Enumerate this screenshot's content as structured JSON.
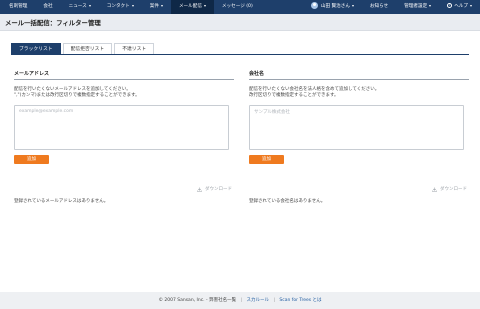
{
  "nav": {
    "items": [
      {
        "label": "名刺管理",
        "caret": false,
        "active": false
      },
      {
        "label": "会社",
        "caret": false,
        "active": false
      },
      {
        "label": "ニュース",
        "caret": true,
        "active": false
      },
      {
        "label": "コンタクト",
        "caret": true,
        "active": false
      },
      {
        "label": "案件",
        "caret": true,
        "active": false
      },
      {
        "label": "メール配信",
        "caret": true,
        "active": true
      },
      {
        "label": "メッセージ (0)",
        "caret": false,
        "active": false
      }
    ],
    "user": "山田 賢治さん",
    "notice": "お知らせ",
    "admin": "管理者設定",
    "help": "ヘルプ"
  },
  "page": {
    "title": "メール一括配信：フィルター管理"
  },
  "tabs": [
    "ブラックリスト",
    "配信拒否リスト",
    "不達リスト"
  ],
  "left_panel": {
    "heading": "メールアドレス",
    "desc_line1": "配信を行いたくないメールアドレスを追加してください。",
    "desc_line2": "\",\"(カンマ)または改行区切りで複数指定することができます。",
    "placeholder": "example@example.com",
    "add_label": "追加",
    "download_label": "ダウンロード",
    "empty_text": "登録されているメールアドレスはありません。"
  },
  "right_panel": {
    "heading": "会社名",
    "desc_line1": "配信を行いたくない会社名を法人格を含めて追加してください。",
    "desc_line2": "改行区切りで複数指定することができます。",
    "placeholder": "サンプル株式会社",
    "add_label": "追加",
    "download_label": "ダウンロード",
    "empty_text": "登録されている会社名はありません。"
  },
  "footer": {
    "copyright": "© 2007 Sansan, Inc. - 弊害社名一覧",
    "link1": "ス力ルール",
    "link2": "Scan for Trees とは",
    "sep": "|"
  }
}
